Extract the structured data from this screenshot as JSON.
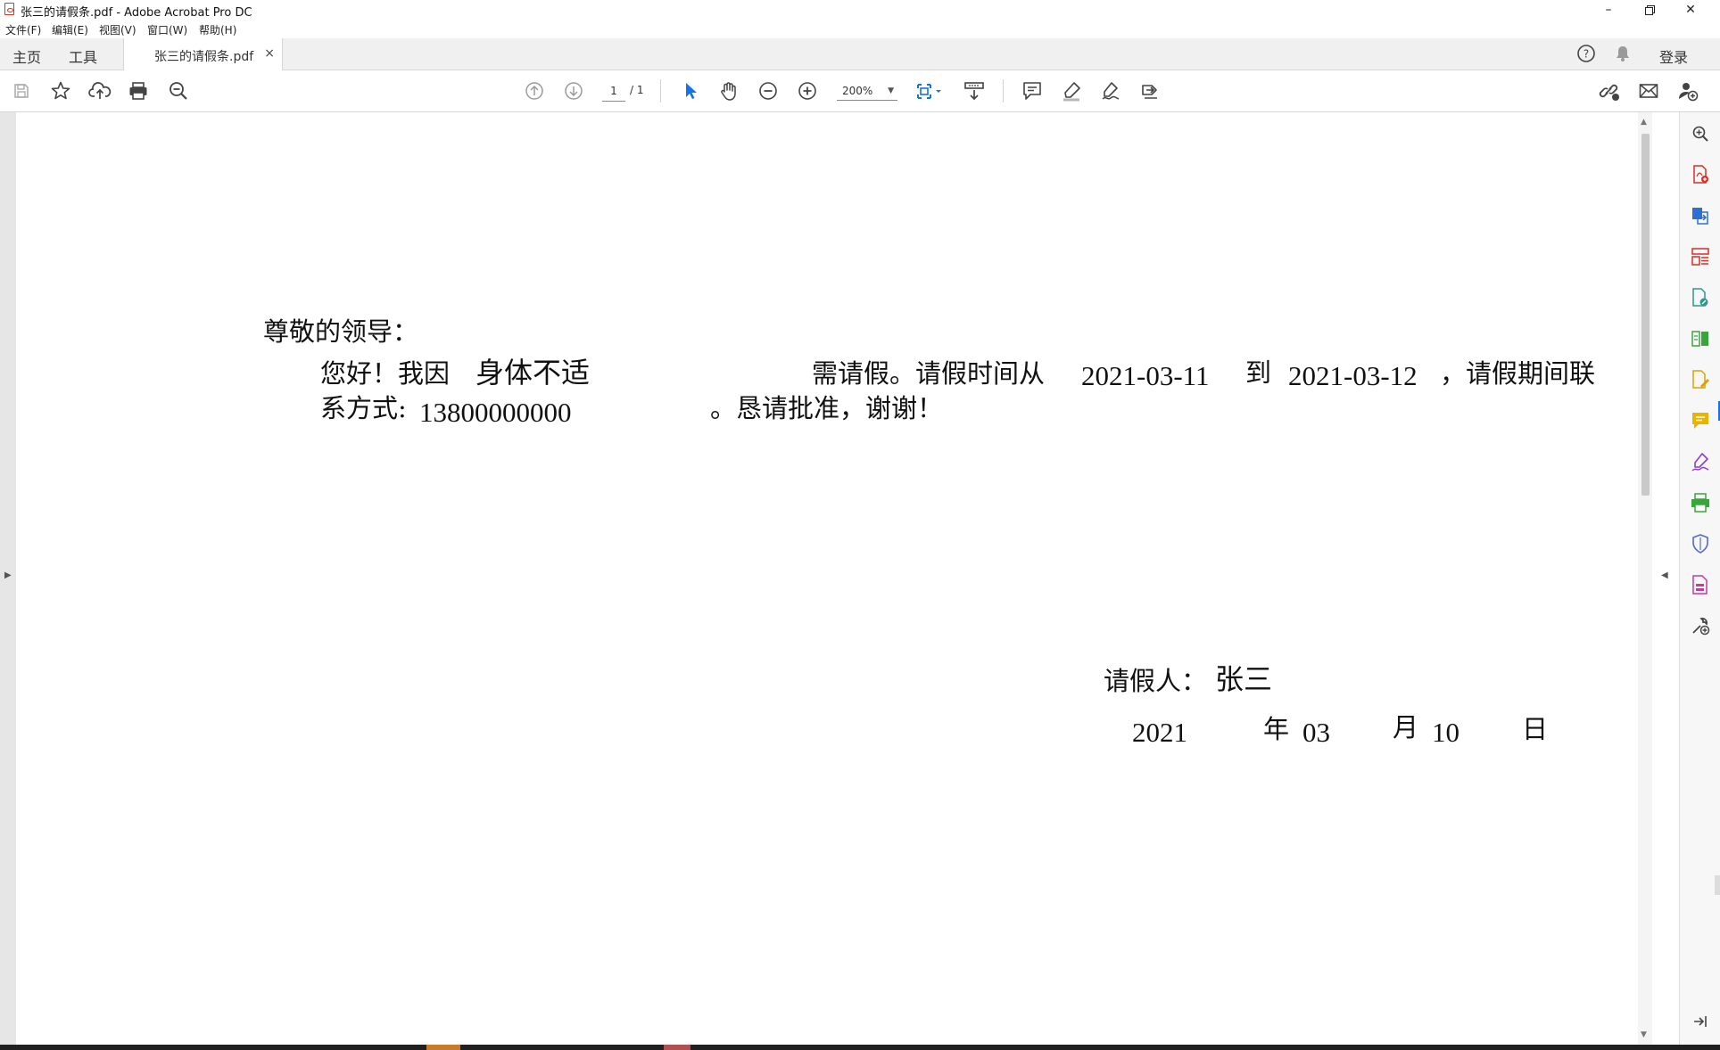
{
  "window": {
    "title": "张三的请假条.pdf - Adobe Acrobat Pro DC"
  },
  "menu": [
    "文件(F)",
    "编辑(E)",
    "视图(V)",
    "窗口(W)",
    "帮助(H)"
  ],
  "tabs": {
    "home": "主页",
    "tools": "工具",
    "document": "张三的请假条.pdf",
    "login": "登录"
  },
  "toolbar": {
    "page_current": "1",
    "page_total": "/ 1",
    "zoom": "200%"
  },
  "document": {
    "salutation": "尊敬的领导：",
    "line1_greeting": "您好！我因",
    "line1_reason": "身体不适",
    "line1_need": "需请假。请假时间从",
    "start_date": "2021-03-11",
    "to": "到",
    "end_date": "2021-03-12",
    "line1_tail": "，请假期间联",
    "line2_label": "系方式:",
    "phone": "13800000000",
    "line2_end": "。恳请批准，谢谢！",
    "signature_label": "请假人：",
    "signature_name": "张三",
    "year": "2021",
    "year_unit": "年",
    "month": "03",
    "month_unit": "月",
    "day": "10",
    "day_unit": "日"
  },
  "colors": {
    "accent": "#1473e6",
    "adobe_red": "#dc2f26",
    "toolbar_bg": "#f0f0f0"
  },
  "icons": {
    "toolbar": [
      "save-icon",
      "star-icon",
      "cloud-upload-icon",
      "print-icon",
      "zoom-search-icon",
      "page-up-icon",
      "page-down-icon",
      "select-arrow-icon",
      "hand-icon",
      "zoom-out-icon",
      "zoom-in-icon",
      "fit-page-icon",
      "scroll-mode-icon",
      "comment-icon",
      "highlight-pen-icon",
      "sign-icon",
      "share-icon",
      "link-icon",
      "email-icon",
      "add-user-icon"
    ],
    "rightpanel": [
      "search-zoom-icon",
      "create-pdf-icon",
      "export-pdf-icon",
      "organize-pages-icon",
      "edit-pdf-icon",
      "compare-icon",
      "fill-sign-icon",
      "comment-panel-icon",
      "fill-draw-icon",
      "scan-icon",
      "protect-icon",
      "prepare-form-icon",
      "more-tools-icon",
      "collapse-panel-icon"
    ]
  }
}
